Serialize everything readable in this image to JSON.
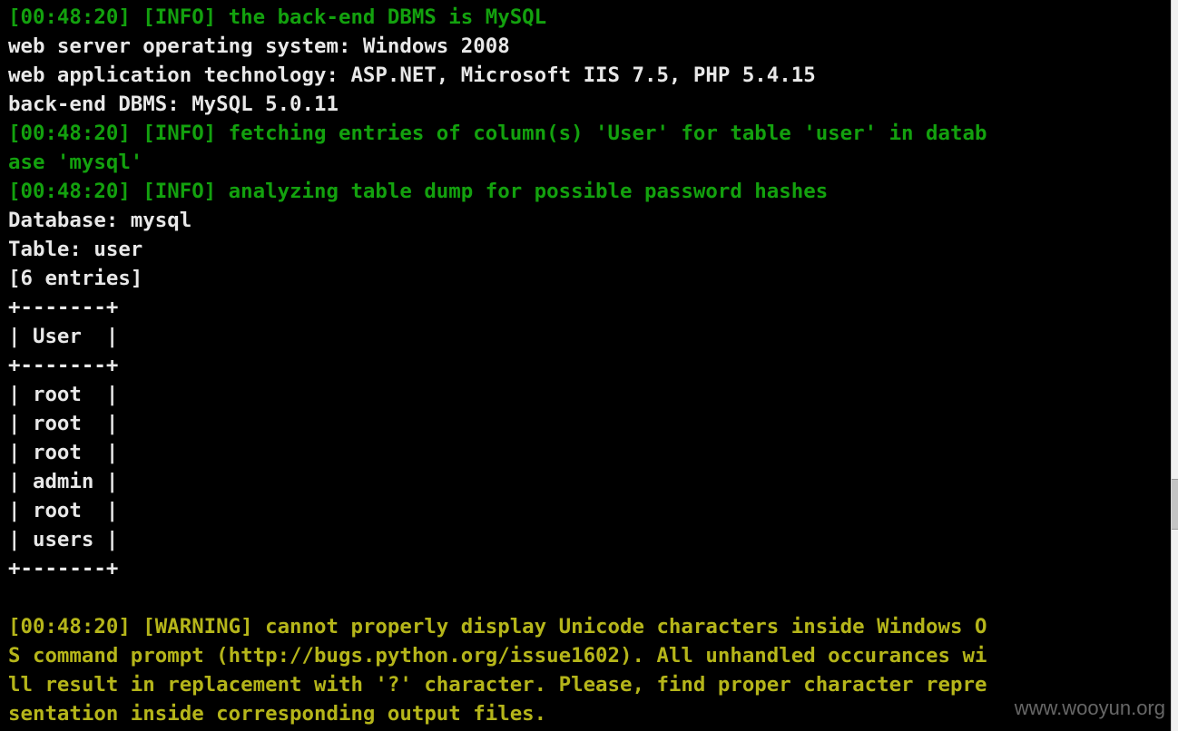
{
  "console": {
    "lines": [
      {
        "text": "[00:48:20] [INFO] the back-end DBMS is MySQL",
        "kind": "info"
      },
      {
        "text": "web server operating system: Windows 2008",
        "kind": "text"
      },
      {
        "text": "web application technology: ASP.NET, Microsoft IIS 7.5, PHP 5.4.15",
        "kind": "text"
      },
      {
        "text": "back-end DBMS: MySQL 5.0.11",
        "kind": "text"
      },
      {
        "text": "[00:48:20] [INFO] fetching entries of column(s) 'User' for table 'user' in datab",
        "kind": "info"
      },
      {
        "text": "ase 'mysql'",
        "kind": "info"
      },
      {
        "text": "[00:48:20] [INFO] analyzing table dump for possible password hashes",
        "kind": "info"
      },
      {
        "text": "Database: mysql",
        "kind": "text"
      },
      {
        "text": "Table: user",
        "kind": "text"
      },
      {
        "text": "[6 entries]",
        "kind": "text"
      },
      {
        "text": "+-------+",
        "kind": "text"
      },
      {
        "text": "| User  |",
        "kind": "text"
      },
      {
        "text": "+-------+",
        "kind": "text"
      },
      {
        "text": "| root  |",
        "kind": "text"
      },
      {
        "text": "| root  |",
        "kind": "text"
      },
      {
        "text": "| root  |",
        "kind": "text"
      },
      {
        "text": "| admin |",
        "kind": "text"
      },
      {
        "text": "| root  |",
        "kind": "text"
      },
      {
        "text": "| users |",
        "kind": "text"
      },
      {
        "text": "+-------+",
        "kind": "text"
      },
      {
        "text": "",
        "kind": "text"
      },
      {
        "text": "[00:48:20] [WARNING] cannot properly display Unicode characters inside Windows O",
        "kind": "warn"
      },
      {
        "text": "S command prompt (http://bugs.python.org/issue1602). All unhandled occurances wi",
        "kind": "warn"
      },
      {
        "text": "ll result in replacement with '?' character. Please, find proper character repre",
        "kind": "warn"
      },
      {
        "text": "sentation inside corresponding output files.",
        "kind": "warn"
      }
    ]
  },
  "watermark": {
    "text": "www.wooyun.org"
  },
  "colors": {
    "background": "#000000",
    "info": "#13a10e",
    "text": "#e8e8e8",
    "warning": "#b5b51a"
  }
}
